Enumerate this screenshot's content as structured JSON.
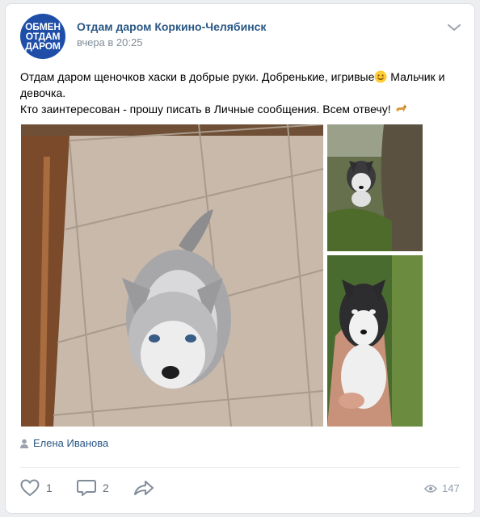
{
  "header": {
    "avatar_lines": [
      "ОБМЕН",
      "ОТДАМ",
      "ДАРОМ"
    ],
    "group_name": "Отдам даром Коркино-Челябинск",
    "post_time": "вчера в 20:25"
  },
  "post": {
    "line1": "Отдам даром щеночков хаски в добрые руки. Добренькие, игривые",
    "line1_end": " Мальчик и",
    "line2": "девочка.",
    "line3": "Кто заинтересован - прошу писать в Личные сообщения. Всем отвечу!",
    "emoji1": "smiling-face-icon",
    "emoji2": "dog-icon"
  },
  "photos": [
    "husky-puppy-on-tiles",
    "husky-puppy-under-tree",
    "husky-puppy-held-in-hands"
  ],
  "author": {
    "name": "Елена Иванова"
  },
  "actions": {
    "likes": "1",
    "comments": "2",
    "views": "147"
  },
  "colors": {
    "link": "#2a5885",
    "avatar_bg": "#1e4ea8",
    "muted": "#818c99"
  }
}
